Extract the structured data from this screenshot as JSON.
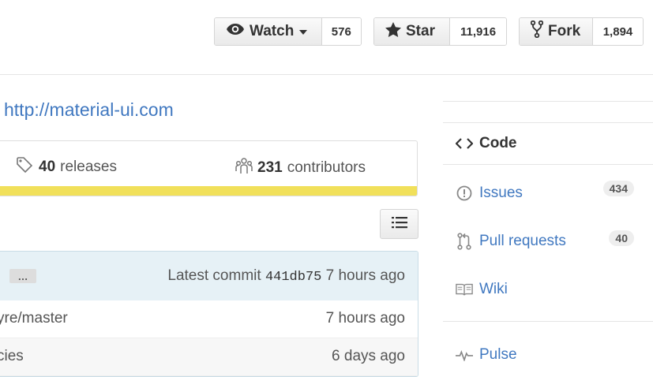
{
  "actions": {
    "watch": {
      "label": "Watch",
      "count": "576"
    },
    "star": {
      "label": "Star",
      "count": "11,916"
    },
    "fork": {
      "label": "Fork",
      "count": "1,894"
    }
  },
  "repo": {
    "homepage": "http://material-ui.com"
  },
  "summary": {
    "releases_count": "40",
    "releases_label": "releases",
    "contributors_count": "231",
    "contributors_label": "contributors",
    "language_color": "#f1e05a"
  },
  "commit": {
    "ellipsis": "…",
    "prefix": "Latest commit",
    "sha": "441db75",
    "age": "7 hours ago"
  },
  "files": [
    {
      "name": "yre/master",
      "age": "7 hours ago"
    },
    {
      "name": "cies",
      "age": "6 days ago"
    }
  ],
  "nav": {
    "code": "Code",
    "issues": {
      "label": "Issues",
      "count": "434"
    },
    "pulls": {
      "label": "Pull requests",
      "count": "40"
    },
    "wiki": "Wiki",
    "pulse": "Pulse"
  },
  "icons": [
    "eye-icon",
    "caret-down-icon",
    "star-icon",
    "fork-icon",
    "tag-icon",
    "organization-icon",
    "list-icon",
    "code-icon",
    "issue-icon",
    "pull-request-icon",
    "book-icon",
    "pulse-icon"
  ]
}
